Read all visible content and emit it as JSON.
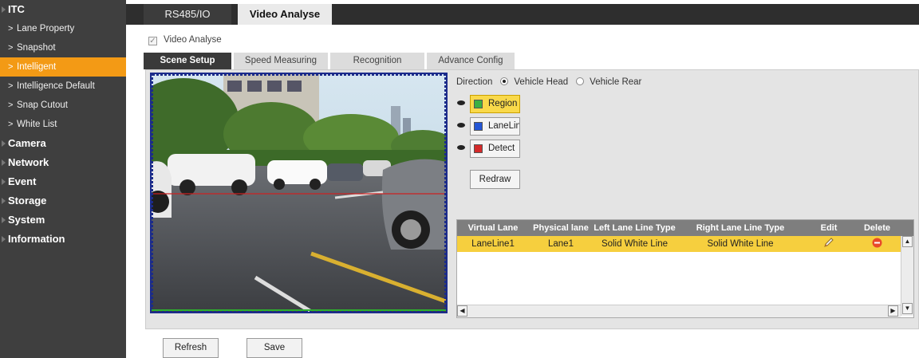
{
  "sidebar": {
    "items": [
      {
        "label": "ITC",
        "level": "top"
      },
      {
        "label": "Lane Property",
        "level": "sub"
      },
      {
        "label": "Snapshot",
        "level": "sub"
      },
      {
        "label": "Intelligent",
        "level": "sub",
        "active": true
      },
      {
        "label": "Intelligence Default",
        "level": "sub"
      },
      {
        "label": "Snap Cutout",
        "level": "sub"
      },
      {
        "label": "White List",
        "level": "sub"
      },
      {
        "label": "Camera",
        "level": "top"
      },
      {
        "label": "Network",
        "level": "top"
      },
      {
        "label": "Event",
        "level": "top"
      },
      {
        "label": "Storage",
        "level": "top"
      },
      {
        "label": "System",
        "level": "top"
      },
      {
        "label": "Information",
        "level": "top"
      }
    ]
  },
  "top_tabs": {
    "rs485": "RS485/IO",
    "video_analyse": "Video Analyse"
  },
  "video_analyse_checkbox": {
    "label": "Video Analyse",
    "checked": true
  },
  "sub_tabs": {
    "scene_setup": "Scene Setup",
    "speed_measuring": "Speed Measuring",
    "recognition": "Recognition",
    "advance_config": "Advance Config"
  },
  "direction": {
    "label": "Direction",
    "head": "Vehicle Head",
    "rear": "Vehicle Rear",
    "selected": "Vehicle Head"
  },
  "draw_buttons": {
    "region": {
      "label": "Region",
      "color": "#3cb043"
    },
    "laneline": {
      "label": "LaneLine",
      "color": "#2456d6"
    },
    "detect": {
      "label": "Detect",
      "color": "#d42a2a"
    }
  },
  "redraw_label": "Redraw",
  "table": {
    "headers": [
      "Virtual Lane",
      "Physical lane",
      "Left Lane Line Type",
      "Right Lane Line Type",
      "Edit",
      "Delete"
    ],
    "rows": [
      {
        "virtual_lane": "LaneLine1",
        "physical_lane": "Lane1",
        "left_type": "Solid White Line",
        "right_type": "Solid White Line"
      }
    ]
  },
  "footer": {
    "refresh": "Refresh",
    "save": "Save"
  },
  "colors": {
    "accent": "#f39a15",
    "selected_row": "#f6cf3e",
    "sidebar_bg": "#3f3f3f",
    "detect_line": "#cc2222",
    "video_frame": "#1b2b8a"
  }
}
